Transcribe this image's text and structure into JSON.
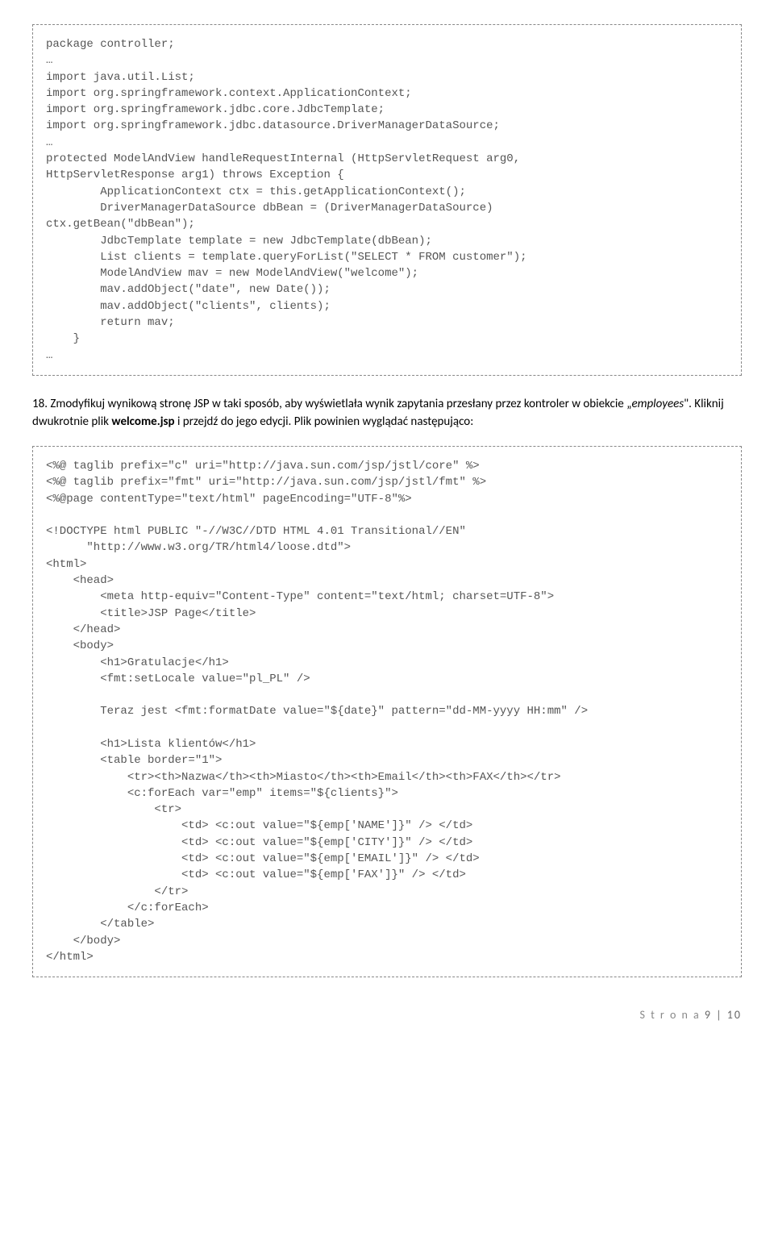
{
  "codebox1": "package controller;\n…\nimport java.util.List;\nimport org.springframework.context.ApplicationContext;\nimport org.springframework.jdbc.core.JdbcTemplate;\nimport org.springframework.jdbc.datasource.DriverManagerDataSource;\n…\nprotected ModelAndView handleRequestInternal (HttpServletRequest arg0,\nHttpServletResponse arg1) throws Exception {\n        ApplicationContext ctx = this.getApplicationContext();\n        DriverManagerDataSource dbBean = (DriverManagerDataSource)\nctx.getBean(\"dbBean\");\n        JdbcTemplate template = new JdbcTemplate(dbBean);\n        List clients = template.queryForList(\"SELECT * FROM customer\");\n        ModelAndView mav = new ModelAndView(\"welcome\");\n        mav.addObject(\"date\", new Date());\n        mav.addObject(\"clients\", clients);\n        return mav;\n    }\n…",
  "para_prefix": "18. Zmodyfikuj wynikową stronę JSP w taki sposób, aby wyświetlała wynik zapytania przesłany przez kontroler w obiekcie „",
  "para_obj": "employees",
  "para_mid1": "\". Kliknij dwukrotnie plik ",
  "para_bold": "welcome.jsp",
  "para_tail": " i przejdź do jego edycji. Plik powinien wyglądać następująco:",
  "codebox2": "<%@ taglib prefix=\"c\" uri=\"http://java.sun.com/jsp/jstl/core\" %>\n<%@ taglib prefix=\"fmt\" uri=\"http://java.sun.com/jsp/jstl/fmt\" %>\n<%@page contentType=\"text/html\" pageEncoding=\"UTF-8\"%>\n\n<!DOCTYPE html PUBLIC \"-//W3C//DTD HTML 4.01 Transitional//EN\"\n      \"http://www.w3.org/TR/html4/loose.dtd\">\n<html>\n    <head>\n        <meta http-equiv=\"Content-Type\" content=\"text/html; charset=UTF-8\">\n        <title>JSP Page</title>\n    </head>\n    <body>\n        <h1>Gratulacje</h1>\n        <fmt:setLocale value=\"pl_PL\" />\n\n        Teraz jest <fmt:formatDate value=\"${date}\" pattern=\"dd-MM-yyyy HH:mm\" />\n\n        <h1>Lista klientów</h1>\n        <table border=\"1\">\n            <tr><th>Nazwa</th><th>Miasto</th><th>Email</th><th>FAX</th></tr>\n            <c:forEach var=\"emp\" items=\"${clients}\">\n                <tr>\n                    <td> <c:out value=\"${emp['NAME']}\" /> </td>\n                    <td> <c:out value=\"${emp['CITY']}\" /> </td>\n                    <td> <c:out value=\"${emp['EMAIL']}\" /> </td>\n                    <td> <c:out value=\"${emp['FAX']}\" /> </td>\n                </tr>\n            </c:forEach>\n        </table>\n    </body>\n</html>",
  "footer_label": "S t r o n a ",
  "footer_page": "9 | 10"
}
